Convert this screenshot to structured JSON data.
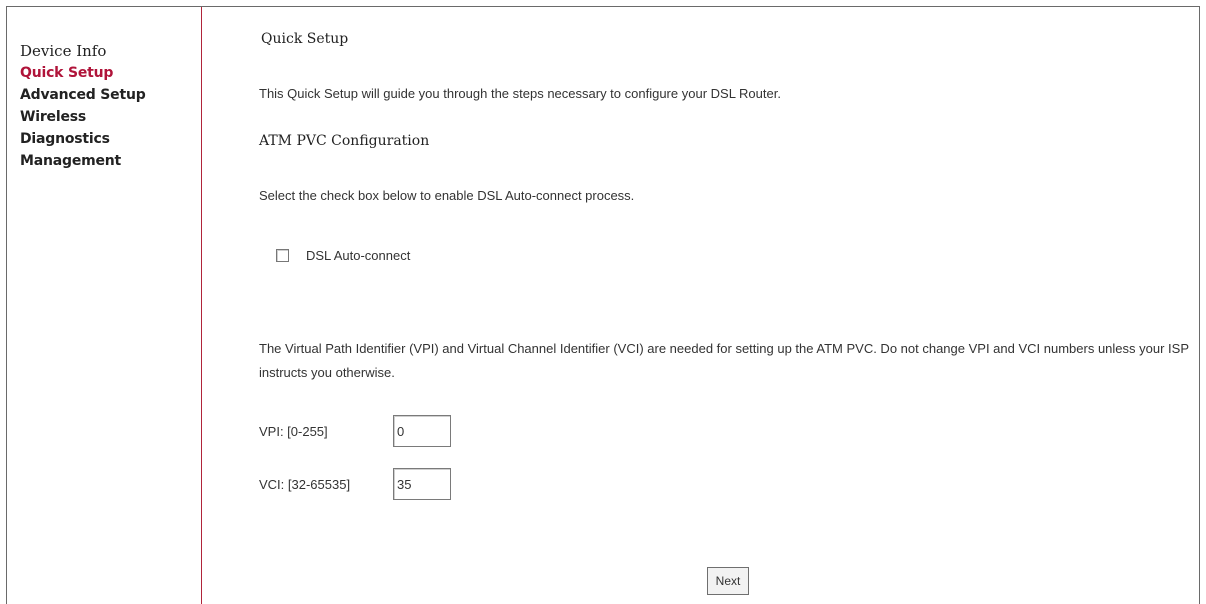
{
  "sidebar": {
    "items": [
      {
        "label": "Device Info",
        "active": false
      },
      {
        "label": "Quick Setup",
        "active": true
      },
      {
        "label": "Advanced Setup",
        "active": false
      },
      {
        "label": "Wireless",
        "active": false
      },
      {
        "label": "Diagnostics",
        "active": false
      },
      {
        "label": "Management",
        "active": false
      }
    ]
  },
  "main": {
    "title": "Quick Setup",
    "intro": "This Quick Setup will guide you through the steps necessary to configure your DSL Router.",
    "section_title": "ATM PVC Configuration",
    "select_instruction": "Select the check box below to enable DSL Auto-connect process.",
    "auto_connect": {
      "label": "DSL Auto-connect",
      "checked": false
    },
    "vpi_vci_note": "The Virtual Path Identifier (VPI) and Virtual Channel Identifier (VCI) are needed for setting up the ATM PVC. Do not change VPI and VCI numbers unless your ISP instructs you otherwise.",
    "vpi": {
      "label": "VPI: [0-255]",
      "value": "0"
    },
    "vci": {
      "label": "VCI: [32-65535]",
      "value": "35"
    },
    "next_label": "Next"
  },
  "colors": {
    "active_link": "#b0143a",
    "divider": "#b0243a"
  }
}
